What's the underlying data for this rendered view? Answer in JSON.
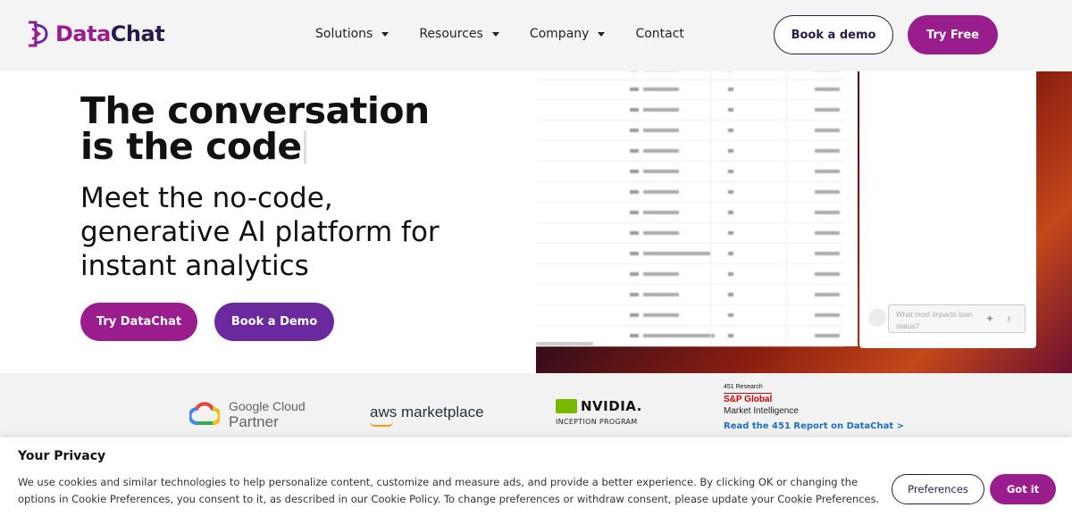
{
  "brand": {
    "name_part1": "Data",
    "name_part2": "Chat",
    "colors": {
      "primary": "#9a1d8e",
      "secondary": "#6a2a9e",
      "dark": "#2a1a4a"
    }
  },
  "nav": {
    "items": [
      {
        "label": "Solutions",
        "has_dropdown": true
      },
      {
        "label": "Resources",
        "has_dropdown": true
      },
      {
        "label": "Company",
        "has_dropdown": true
      },
      {
        "label": "Contact",
        "has_dropdown": false
      }
    ],
    "book_demo_label": "Book a demo",
    "try_free_label": "Try Free"
  },
  "hero": {
    "title_line1": "The conversation",
    "title_line2": "is the code",
    "subtitle": "Meet the no-code, generative AI platform for instant analytics",
    "try_button": "Try DataChat",
    "demo_button": "Book a Demo",
    "chat_placeholder": "What most impacts loan status?"
  },
  "partners": {
    "google": {
      "line1": "Google Cloud",
      "line2": "Partner"
    },
    "aws": "aws marketplace",
    "nvidia": {
      "word": "NVIDIA.",
      "sub": "INCEPTION PROGRAM"
    },
    "report": {
      "line1": "451 Research",
      "line2": "S&P Global",
      "line3": "Market Intelligence",
      "link": "Read the 451 Report on DataChat >"
    }
  },
  "cookie": {
    "title": "Your Privacy",
    "body": "We use cookies and similar technologies to help personalize content, customize and measure ads, and provide a better experience. By clicking OK or changing the options in Cookie Preferences, you consent to it, as described in our Cookie Policy. To change preferences or withdraw consent, please update your Cookie Preferences.",
    "preferences_button": "Preferences",
    "ok_button": "Got it"
  }
}
